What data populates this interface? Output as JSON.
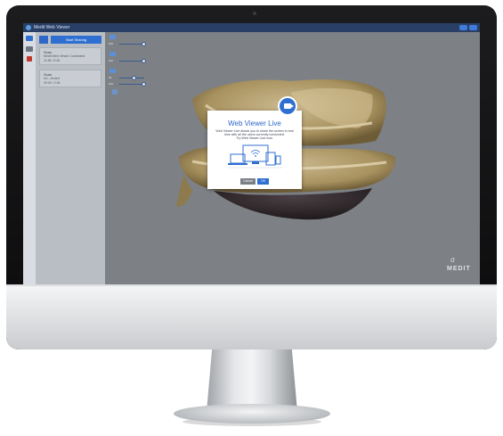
{
  "app": {
    "title": "Medit Web Viewer"
  },
  "left_panel": {
    "share_button_label": "Start Sharing",
    "cards": [
      {
        "title": "Scan",
        "line1": "Medit Web Viewer Connected",
        "line2": "11:58 / 5:26"
      },
      {
        "title": "Scan",
        "line1": "Un...Jected",
        "line2": "00:00 / 2:26"
      }
    ]
  },
  "controls": {
    "values": [
      "100",
      "100",
      "50",
      "100"
    ]
  },
  "modal": {
    "title": "Web Viewer Live",
    "body_lines": [
      "Web Viewer Live allows you to share the screen in real",
      "time with all the users currently connected.",
      "Try Web Viewer Live now."
    ],
    "cancel_label": "Cancel",
    "ok_label": "OK"
  },
  "watermark": {
    "brand": "MEDIT"
  },
  "icons": {
    "camera": "video-camera-icon",
    "devices": "devices-illustration",
    "logo": "medit-logo-icon"
  },
  "colors": {
    "accent": "#2f6fd1",
    "titlebar": "#2a3f66",
    "viewport": "#7d8185"
  }
}
